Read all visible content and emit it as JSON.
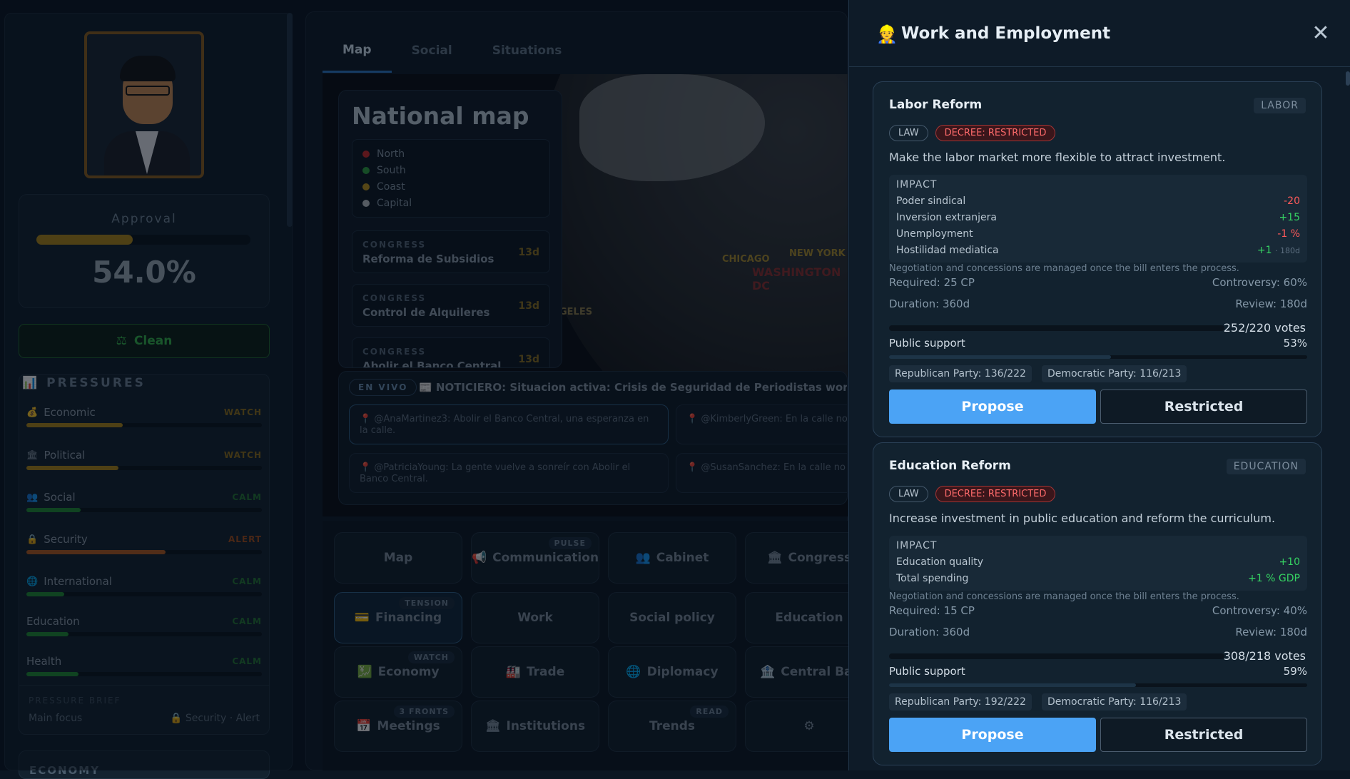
{
  "sidebar": {
    "approval_label": "Approval",
    "approval_value": "54.0%",
    "approval_pct": 0.45,
    "clean_label": "Clean",
    "pressures_title": "PRESSURES",
    "pressures": [
      {
        "name": "Economic",
        "status": "WATCH",
        "level": 0.41,
        "color": "#a8841a",
        "status_color": "#8c6d1c"
      },
      {
        "name": "Political",
        "status": "WATCH",
        "level": 0.39,
        "color": "#a8841a",
        "status_color": "#8c6d1c"
      },
      {
        "name": "Social",
        "status": "CALM",
        "level": 0.23,
        "color": "#1f8a33",
        "status_color": "#257534"
      },
      {
        "name": "Security",
        "status": "ALERT",
        "level": 0.59,
        "color": "#b05a1f",
        "status_color": "#a04c1c"
      },
      {
        "name": "International",
        "status": "CALM",
        "level": 0.16,
        "color": "#1f8a33",
        "status_color": "#257534"
      },
      {
        "name": "Education",
        "status": "CALM",
        "level": 0.18,
        "color": "#1f8a33",
        "status_color": "#257534"
      },
      {
        "name": "Health",
        "status": "CALM",
        "level": 0.22,
        "color": "#1f8a33",
        "status_color": "#257534"
      }
    ],
    "brief_title": "PRESSURE BRIEF",
    "brief_main": "Main focus",
    "brief_focus": "Security · Alert",
    "economy_title": "ECONOMY"
  },
  "main": {
    "tabs": [
      "Map",
      "Social",
      "Situations"
    ],
    "map_title": "National map",
    "legend": [
      {
        "name": "North",
        "color": "#c62828"
      },
      {
        "name": "South",
        "color": "#2e9e3e"
      },
      {
        "name": "Coast",
        "color": "#b8901c"
      },
      {
        "name": "Capital",
        "color": "#b9bec4"
      }
    ],
    "bills": [
      {
        "kind": "CONGRESS",
        "name": "Reforma de Subsidios",
        "days": "13d"
      },
      {
        "kind": "CONGRESS",
        "name": "Control de Alquileres",
        "days": "13d"
      },
      {
        "kind": "CONGRESS",
        "name": "Abolir el Banco Central",
        "days": "13d"
      }
    ],
    "cities": {
      "chicago": "CHICAGO",
      "newyork": "NEW YORK",
      "washington": "WASHINGTON DC",
      "angeles": "GELES"
    },
    "live_label": "EN VIVO",
    "ticker": "📰 NOTICIERO: Situacion activa: Crisis de Seguridad de Periodistas worsens, accor",
    "tweets": [
      "@AnaMartinez3: Abolir el Banco Central, una esperanza en la calle.",
      "@KimberlyGreen: En la calle no s Seguridad de Periodistas.",
      "@PatriciaYoung: La gente vuelve a sonreír con Abolir el Banco Central.",
      "@SusanSanchez: En la calle no s Seguridad de Periodistas."
    ],
    "grid": [
      {
        "label": "Map",
        "icon": "",
        "badge": ""
      },
      {
        "label": "Communication",
        "icon": "📢",
        "badge": "PULSE"
      },
      {
        "label": "Cabinet",
        "icon": "👥",
        "badge": ""
      },
      {
        "label": "Congress",
        "icon": "🏛",
        "badge": ""
      },
      {
        "label": "Financing",
        "icon": "💳",
        "badge": "TENSION"
      },
      {
        "label": "Work",
        "icon": "",
        "badge": ""
      },
      {
        "label": "Social policy",
        "icon": "",
        "badge": ""
      },
      {
        "label": "Education",
        "icon": "",
        "badge": ""
      },
      {
        "label": "Economy",
        "icon": "💹",
        "badge": "WATCH"
      },
      {
        "label": "Trade",
        "icon": "🏭",
        "badge": ""
      },
      {
        "label": "Diplomacy",
        "icon": "🌐",
        "badge": ""
      },
      {
        "label": "Central Bar",
        "icon": "🏦",
        "badge": ""
      },
      {
        "label": "Meetings",
        "icon": "📅",
        "badge": "3 FRONTS"
      },
      {
        "label": "Institutions",
        "icon": "🏛",
        "badge": ""
      },
      {
        "label": "Trends",
        "icon": "",
        "badge": "READ"
      },
      {
        "label": "",
        "icon": "⚙",
        "badge": ""
      }
    ]
  },
  "panel": {
    "icon": "👷",
    "title": "Work and Employment",
    "close": "✕",
    "laws": [
      {
        "title": "Labor Reform",
        "category": "LABOR",
        "tag1": "LAW",
        "tag2": "DECREE: RESTRICTED",
        "desc": "Make the labor market more flexible to attract investment.",
        "impact_title": "IMPACT",
        "impacts": [
          {
            "name": "Poder sindical",
            "value": "-20",
            "sign": "neg",
            "extra": ""
          },
          {
            "name": "Inversion extranjera",
            "value": "+15",
            "sign": "pos",
            "extra": ""
          },
          {
            "name": "Unemployment",
            "value": "-1 %",
            "sign": "neg",
            "extra": ""
          },
          {
            "name": "Hostilidad mediatica",
            "value": "+1",
            "sign": "pos",
            "extra": "· 180d"
          }
        ],
        "note": "Negotiation and concessions are managed once the bill enters the process.",
        "required": "Required: 25 CP",
        "controversy": "Controversy: 60%",
        "duration": "Duration: 360d",
        "review": "Review: 180d",
        "votes": "252/220 votes",
        "support_label": "Public support",
        "support": "53%",
        "support_pct": 0.53,
        "party1": "Republican Party: 136/222",
        "party2": "Democratic Party: 116/213",
        "propose": "Propose",
        "restricted": "Restricted"
      },
      {
        "title": "Education Reform",
        "category": "EDUCATION",
        "tag1": "LAW",
        "tag2": "DECREE: RESTRICTED",
        "desc": "Increase investment in public education and reform the curriculum.",
        "impact_title": "IMPACT",
        "impacts": [
          {
            "name": "Education quality",
            "value": "+10",
            "sign": "pos",
            "extra": ""
          },
          {
            "name": "Total spending",
            "value": "+1 % GDP",
            "sign": "pos",
            "extra": ""
          }
        ],
        "note": "Negotiation and concessions are managed once the bill enters the process.",
        "required": "Required: 15 CP",
        "controversy": "Controversy: 40%",
        "duration": "Duration: 360d",
        "review": "Review: 180d",
        "votes": "308/218 votes",
        "support_label": "Public support",
        "support": "59%",
        "support_pct": 0.59,
        "party1": "Republican Party: 192/222",
        "party2": "Democratic Party: 116/213",
        "propose": "Propose",
        "restricted": "Restricted"
      }
    ]
  }
}
